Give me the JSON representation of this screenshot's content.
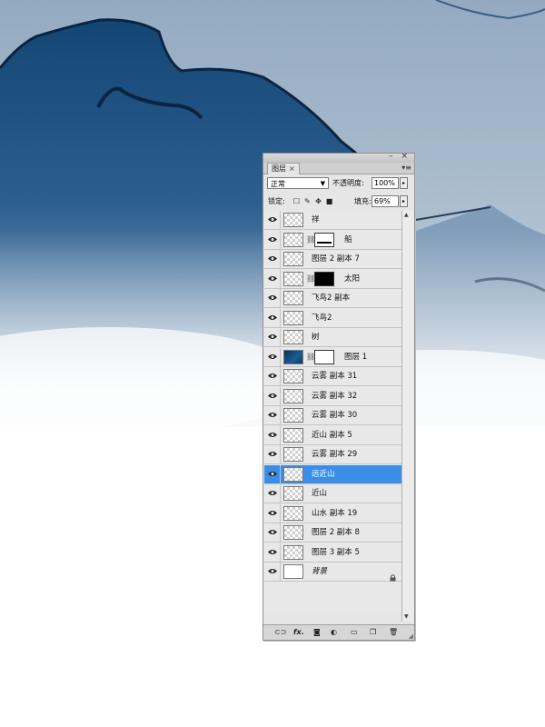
{
  "panel": {
    "tab_label": "图层",
    "tab_close": "×",
    "blend_mode": "正常",
    "opacity_label": "不透明度:",
    "opacity_value": "100%",
    "lock_label": "锁定:",
    "fill_label": "填充:",
    "fill_value": "69%"
  },
  "layers": [
    {
      "name": "祥"
    },
    {
      "name": "船"
    },
    {
      "name": "图层 2 副本 7"
    },
    {
      "name": "太阳"
    },
    {
      "name": "飞鸟2 副本"
    },
    {
      "name": "飞鸟2"
    },
    {
      "name": "树"
    },
    {
      "name": "图层 1"
    },
    {
      "name": "云雾 副本 31"
    },
    {
      "name": "云雾 副本 32"
    },
    {
      "name": "云雾 副本 30"
    },
    {
      "name": "近山 副本 5"
    },
    {
      "name": "云雾 副本 29"
    },
    {
      "name": "远近山",
      "selected": true
    },
    {
      "name": "近山"
    },
    {
      "name": "山水 副本 19"
    },
    {
      "name": "图层 2 副本 8"
    },
    {
      "name": "图层 3 副本 5"
    },
    {
      "name": "背景",
      "locked": true
    }
  ],
  "icons": {
    "eye": "eye-icon",
    "chain": "link-icon",
    "lock": "lock-icon",
    "bottom": [
      "link-layers-icon",
      "fx-icon",
      "add-mask-icon",
      "adjustment-layer-icon",
      "new-group-icon",
      "new-layer-icon",
      "trash-icon"
    ]
  },
  "colors": {
    "selection": "#3a8ee6",
    "mountain": "#1c4f82",
    "sky": "#9fb4c8"
  }
}
